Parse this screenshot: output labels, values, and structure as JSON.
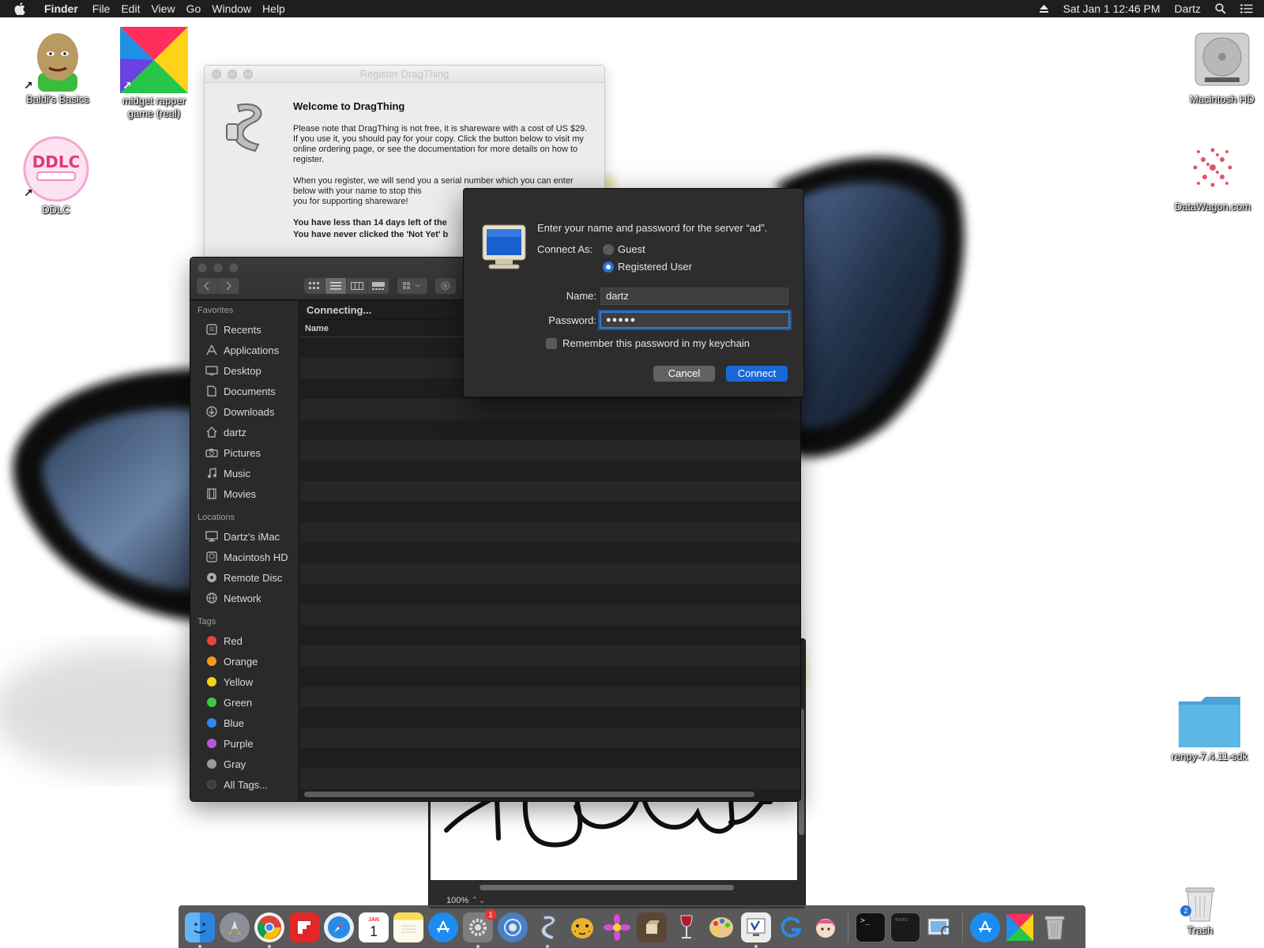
{
  "menubar": {
    "app": "Finder",
    "items": [
      "File",
      "Edit",
      "View",
      "Go",
      "Window",
      "Help"
    ],
    "clock": "Sat Jan 1  12:46 PM",
    "user": "Dartz"
  },
  "desktop_icons": {
    "baldi": "Baldi's Basics",
    "midget1": "midget rapper",
    "midget2": "game (real)",
    "ddlc": "DDLC",
    "macintosh_hd": "Macintosh HD",
    "datawagon": "DataWagon.com",
    "renpy": "renpy-7.4.11-sdk",
    "trash": "Trash",
    "trash_badge": "2"
  },
  "register": {
    "title": "Register DragThing",
    "heading": "Welcome to DragThing",
    "p1": "Please note that DragThing is not free, it is shareware with a cost of US $29. If you use it, you should pay for your copy. Click the button below to visit my online ordering page, or see the documentation for more details on how to register.",
    "p2": "When you register, we will send you a serial number which you can enter below with your name to stop this",
    "p2b": "you for supporting shareware!",
    "p3": "You have less than 14 days left of the",
    "p4": "You have never clicked the 'Not Yet' b"
  },
  "finder": {
    "status": "Connecting...",
    "column_name": "Name",
    "favorites_header": "Favorites",
    "favorites": [
      "Recents",
      "Applications",
      "Desktop",
      "Documents",
      "Downloads",
      "dartz",
      "Pictures",
      "Music",
      "Movies"
    ],
    "locations_header": "Locations",
    "locations": [
      "Dartz's iMac",
      "Macintosh HD",
      "Remote Disc",
      "Network"
    ],
    "tags_header": "Tags",
    "tags": [
      {
        "label": "Red",
        "color": "#e8453c"
      },
      {
        "label": "Orange",
        "color": "#f39a1e"
      },
      {
        "label": "Yellow",
        "color": "#f4d21c"
      },
      {
        "label": "Green",
        "color": "#3ec93e"
      },
      {
        "label": "Blue",
        "color": "#2f86f0"
      },
      {
        "label": "Purple",
        "color": "#b45ad6"
      },
      {
        "label": "Gray",
        "color": "#9a9a9a"
      }
    ],
    "all_tags": "All Tags..."
  },
  "connect_dialog": {
    "prompt": "Enter your name and password for the server “ad”.",
    "connect_as_label": "Connect As:",
    "guest_label": "Guest",
    "registered_label": "Registered User",
    "selected": "Registered User",
    "name_label": "Name:",
    "name_value": "dartz",
    "password_label": "Password:",
    "password_value": "●●●●●",
    "remember_label": "Remember this password in my keychain",
    "remember_checked": false,
    "cancel_label": "Cancel",
    "connect_label": "Connect",
    "accent": "#1868d8"
  },
  "preview": {
    "zoom": "100%"
  },
  "dock": {
    "apps": [
      "finder-icon",
      "launchpad-icon",
      "chrome-icon",
      "flipboard-icon",
      "safari-icon",
      "calendar-icon",
      "notes-icon",
      "app-store-icon",
      "system-preferences-icon",
      "network-utility-icon",
      "dragthing-icon",
      "cheetah-icon",
      "flower-icon",
      "cube-icon",
      "wine-icon",
      "paint-icon",
      "vnc-icon",
      "g-icon",
      "anime-icon",
      "terminal-icon",
      "console-icon",
      "preview-icon",
      "app-store-2-icon",
      "midget-icon",
      "trash-icon"
    ],
    "calendar_month": "JAN",
    "calendar_day": "1",
    "sysprefs_badge": "1"
  }
}
